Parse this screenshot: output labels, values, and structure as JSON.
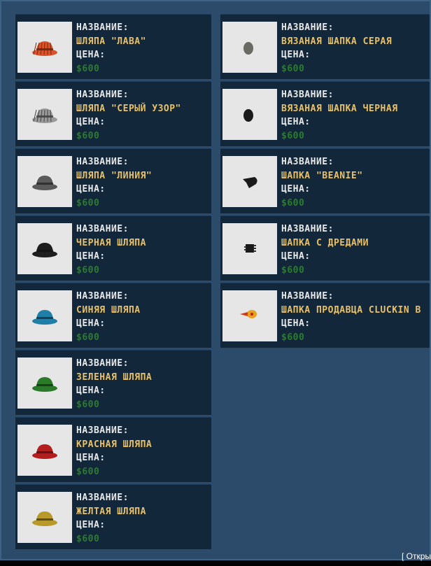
{
  "labels": {
    "name": "НАЗВАНИЕ:",
    "price": "ЦЕНА:"
  },
  "left_items": [
    {
      "title": "ШЛЯПА \"ЛАВА\"",
      "price": "$600",
      "icon": "lava-hat-icon",
      "color": "#d9542a"
    },
    {
      "title": "ШЛЯПА \"СЕРЫЙ УЗОР\"",
      "price": "$600",
      "icon": "gray-pattern-hat-icon",
      "color": "#9a9a9a"
    },
    {
      "title": "ШЛЯПА \"ЛИНИЯ\"",
      "price": "$600",
      "icon": "line-hat-icon",
      "color": "#5a5a5a"
    },
    {
      "title": "ЧЕРНАЯ ШЛЯПА",
      "price": "$600",
      "icon": "black-hat-icon",
      "color": "#1e1e1e"
    },
    {
      "title": "СИНЯЯ ШЛЯПА",
      "price": "$600",
      "icon": "blue-hat-icon",
      "color": "#1f7fa6"
    },
    {
      "title": "ЗЕЛЕНАЯ ШЛЯПА",
      "price": "$600",
      "icon": "green-hat-icon",
      "color": "#2a7a2a"
    },
    {
      "title": "КРАСНАЯ ШЛЯПА",
      "price": "$600",
      "icon": "red-hat-icon",
      "color": "#b31e1e"
    },
    {
      "title": "ЖЕЛТАЯ ШЛЯПА",
      "price": "$600",
      "icon": "yellow-hat-icon",
      "color": "#b89a2a"
    }
  ],
  "right_items": [
    {
      "title": "ВЯЗАНАЯ ШАПКА СЕРАЯ",
      "price": "$600",
      "icon": "gray-knit-cap-icon",
      "color": "#6a6a64"
    },
    {
      "title": "ВЯЗАНАЯ ШАПКА ЧЕРНАЯ",
      "price": "$600",
      "icon": "black-knit-cap-icon",
      "color": "#1a1a1a"
    },
    {
      "title": "ШАПКА \"BEANIE\"",
      "price": "$600",
      "icon": "beanie-icon",
      "color": "#1a1a1a"
    },
    {
      "title": "ШАПКА С ДРЕДАМИ",
      "price": "$600",
      "icon": "dreadlocks-cap-icon",
      "color": "#1a1a1a"
    },
    {
      "title": "ШАПКА ПРОДАВЦА CLUCKIN B",
      "price": "$600",
      "icon": "cluckin-bell-cap-icon",
      "color": "#e8a020"
    }
  ],
  "footer": {
    "text": "[ Открыть ]"
  }
}
